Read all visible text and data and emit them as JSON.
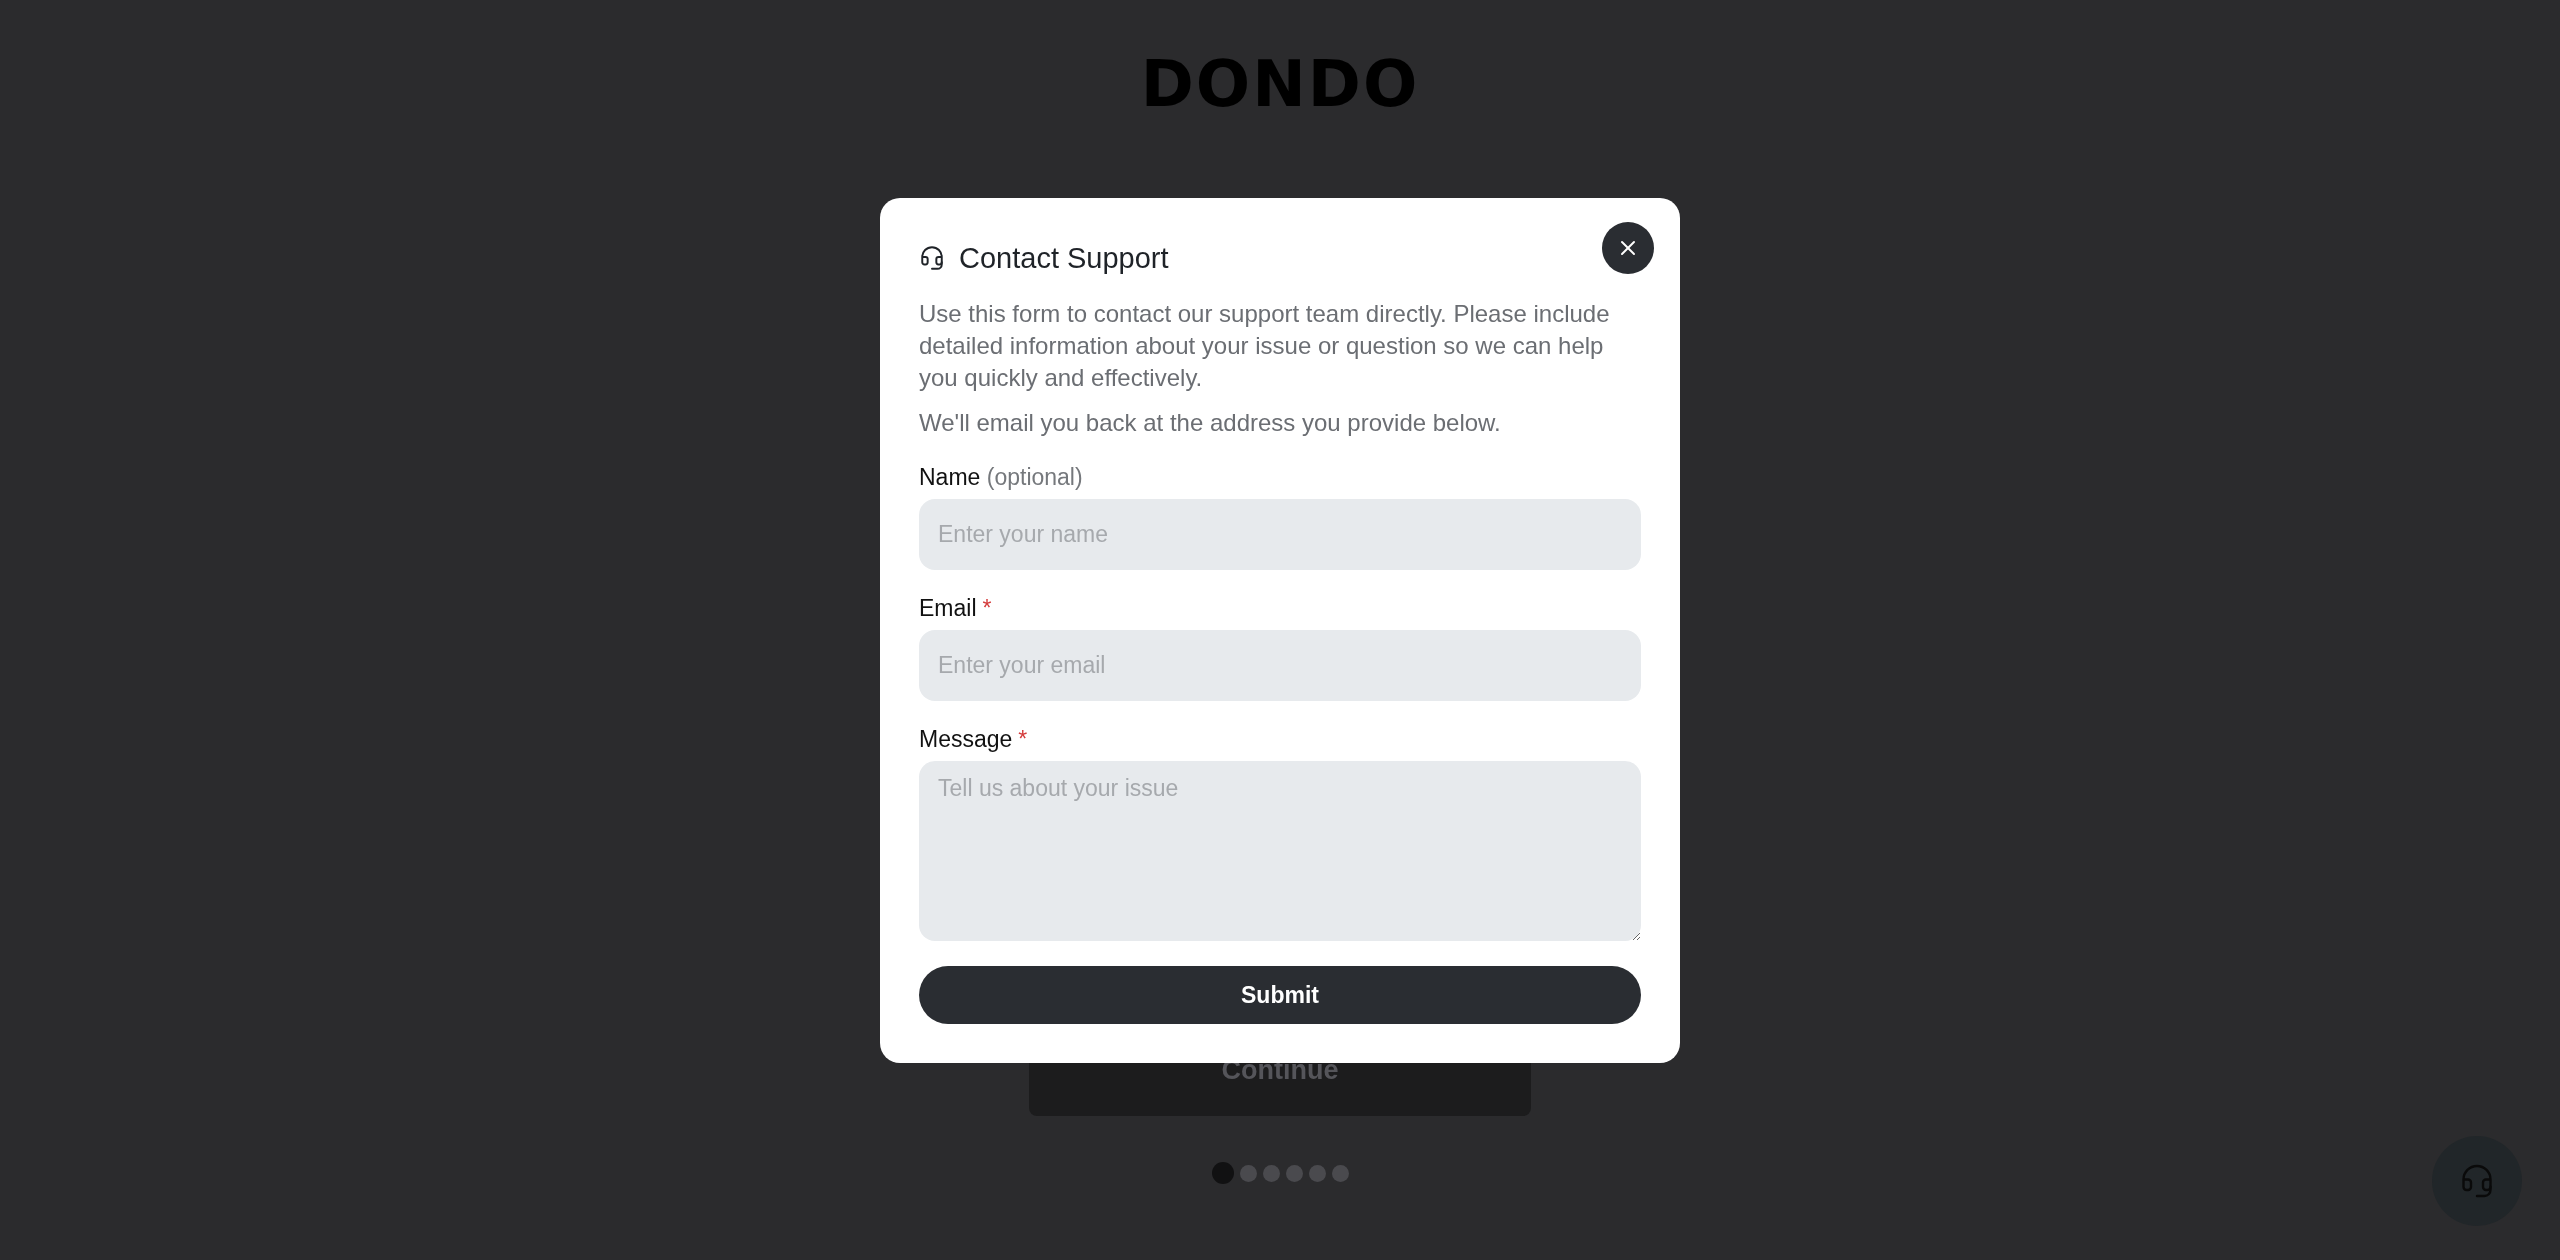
{
  "logo": {
    "text": "DONDO"
  },
  "dialog": {
    "title": "Contact Support",
    "paragraphs": [
      "Use this form to contact our support team directly. Please include detailed information about your issue or question so we can help you quickly and effectively.",
      "We'll email you back at the address you provide below."
    ],
    "fields": [
      {
        "kind": "input",
        "label": "Name",
        "note": "(optional)",
        "placeholder": "Enter your name"
      },
      {
        "kind": "input",
        "label": "Email",
        "required_mark": "*",
        "placeholder": "Enter your email"
      },
      {
        "kind": "textarea",
        "label": "Message",
        "required_mark": "*",
        "placeholder": "Tell us about your issue"
      }
    ],
    "submit": "Submit"
  },
  "continue_button": {
    "label": "Continue",
    "disabled": true
  },
  "pager": [
    {
      "selected": true
    },
    {
      "selected": false
    },
    {
      "selected": false
    },
    {
      "selected": false
    },
    {
      "selected": false
    },
    {
      "selected": false
    }
  ]
}
